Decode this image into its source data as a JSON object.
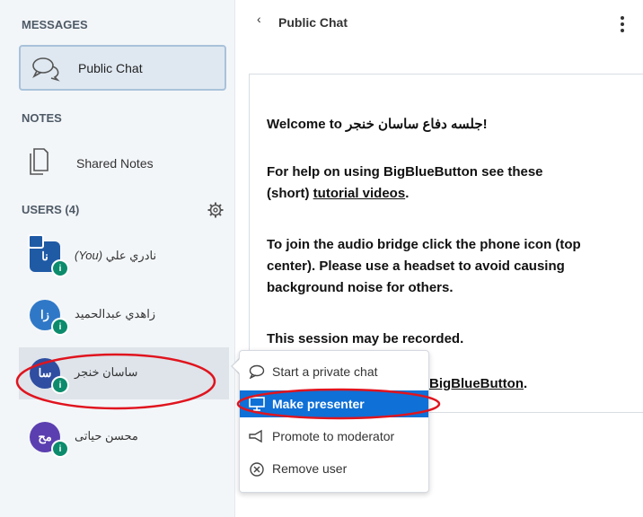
{
  "sidebar": {
    "messages_title": "MESSAGES",
    "public_chat_label": "Public Chat",
    "notes_title": "NOTES",
    "shared_notes_label": "Shared Notes",
    "users_title": "USERS (4)",
    "users": [
      {
        "initials": "نا",
        "name": "نادري علي",
        "you_tag": "(You)",
        "color": "#1f5aa5",
        "presenter": true
      },
      {
        "initials": "زا",
        "name": "زاهدي عبدالحميد",
        "color": "#2f78c7"
      },
      {
        "initials": "سا",
        "name": "ساسان خنجر",
        "color": "#2f4ea1",
        "selected": true
      },
      {
        "initials": "مح",
        "name": "محسن حياتی",
        "color": "#5b3fb0"
      }
    ]
  },
  "header": {
    "back_icon": "‹",
    "title": "Public Chat"
  },
  "welcome": {
    "line1": "Welcome to جلسه دفاع ساسان خنجر!",
    "line2a": "For help on using BigBlueButton see these",
    "line2b_pre": "(short) ",
    "line2b_link": "tutorial videos",
    "line2b_post": ".",
    "line3a": "To join the audio bridge click the phone icon (top",
    "line3b": "center). Please use a headset to avoid causing",
    "line3c": "background noise for others.",
    "line4": "This session may be recorded.",
    "line5_link": "BigBlueButton",
    "line5_post": "."
  },
  "context_menu": {
    "items": [
      {
        "label": "Start a private chat",
        "icon": "chat-bubble-icon"
      },
      {
        "label": "Make presenter",
        "icon": "presentation-icon"
      },
      {
        "label": "Promote to moderator",
        "icon": "promote-icon"
      },
      {
        "label": "Remove user",
        "icon": "circle-x-icon"
      }
    ]
  },
  "colors": {
    "accent": "#0f70d7",
    "annotation": "#e0141e",
    "mic_badge": "#0c8c6c"
  }
}
